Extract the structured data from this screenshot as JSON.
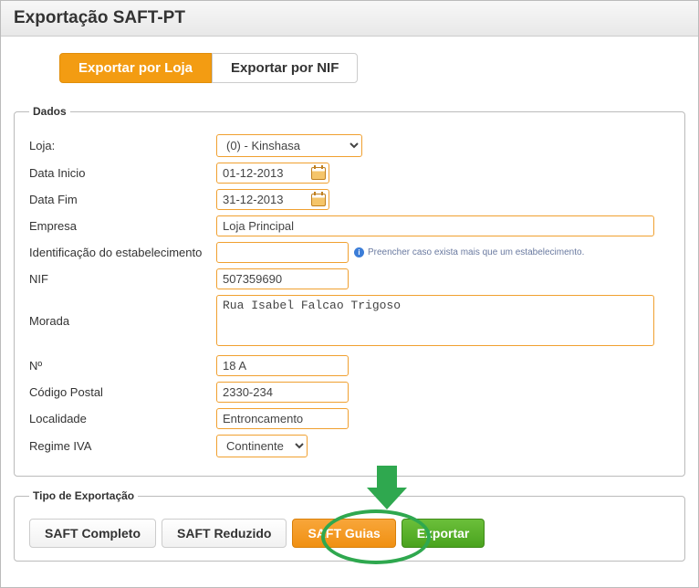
{
  "titlebar": "Exportação SAFT-PT",
  "tabs": {
    "by_store": "Exportar por Loja",
    "by_nif": "Exportar por NIF"
  },
  "dados": {
    "legend": "Dados",
    "loja_label": "Loja:",
    "loja_value": "(0) - Kinshasa",
    "data_inicio_label": "Data Inicio",
    "data_inicio_value": "01-12-2013",
    "data_fim_label": "Data Fim",
    "data_fim_value": "31-12-2013",
    "empresa_label": "Empresa",
    "empresa_value": "Loja Principal",
    "estab_label": "Identificação do estabelecimento",
    "estab_value": "",
    "estab_hint": "Preencher caso exista mais que um estabelecimento.",
    "nif_label": "NIF",
    "nif_value": "507359690",
    "morada_label": "Morada",
    "morada_value": "Rua Isabel Falcao Trigoso",
    "numero_label": "Nº",
    "numero_value": "18 A",
    "cp_label": "Código Postal",
    "cp_value": "2330-234",
    "localidade_label": "Localidade",
    "localidade_value": "Entroncamento",
    "regime_label": "Regime IVA",
    "regime_value": "Continente"
  },
  "export": {
    "legend": "Tipo de Exportação",
    "completo": "SAFT Completo",
    "reduzido": "SAFT Reduzido",
    "guias": "SAFT Guias",
    "exportar": "Exportar"
  }
}
